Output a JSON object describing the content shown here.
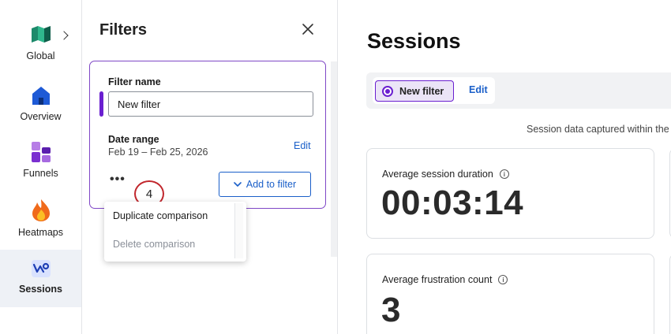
{
  "nav": {
    "items": [
      {
        "label": "Global",
        "icon": "global-logo-icon"
      },
      {
        "label": "Overview",
        "icon": "house-icon"
      },
      {
        "label": "Funnels",
        "icon": "funnels-icon"
      },
      {
        "label": "Heatmaps",
        "icon": "flame-icon"
      },
      {
        "label": "Sessions",
        "icon": "sessions-icon",
        "active": true
      }
    ]
  },
  "filters_panel": {
    "title": "Filters",
    "filter_name_label": "Filter name",
    "filter_name_value": "New filter",
    "date_range_label": "Date range",
    "date_range_value": "Feb 19 – Feb 25, 2026",
    "date_edit_label": "Edit",
    "more_label": "•••",
    "add_to_filter_label": "Add to filter",
    "step_badge": "4",
    "menu": {
      "duplicate_label": "Duplicate comparison",
      "delete_label": "Delete comparison"
    }
  },
  "main": {
    "title": "Sessions",
    "filter_pill_label": "New filter",
    "filter_edit_label": "Edit",
    "caption": "Session data captured within the",
    "metrics": [
      {
        "label": "Average session duration",
        "value": "00:03:14"
      },
      {
        "label": "Average frustration count",
        "value": "3"
      }
    ]
  },
  "colors": {
    "accent_purple": "#6a1fd0",
    "link_blue": "#1a5fc9",
    "step_badge_red": "#c1272d"
  }
}
